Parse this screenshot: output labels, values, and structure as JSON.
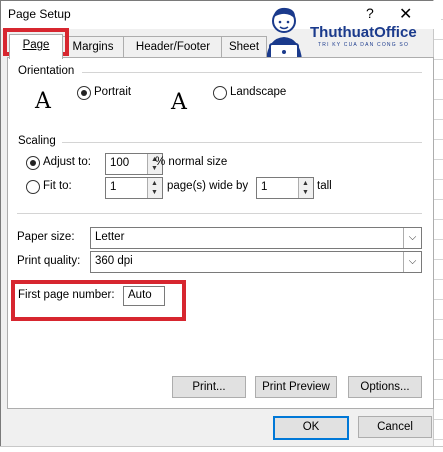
{
  "window": {
    "title": "Page Setup",
    "help_glyph": "?",
    "close_glyph": "✕"
  },
  "watermark": {
    "name": "ThuthuatOffice",
    "tagline": "TRI KY CUA DAN CONG SO"
  },
  "tabs": [
    {
      "label": "Page",
      "active": true
    },
    {
      "label": "Margins"
    },
    {
      "label": "Header/Footer"
    },
    {
      "label": "Sheet"
    }
  ],
  "orientation": {
    "heading": "Orientation",
    "portrait_label": "Portrait",
    "landscape_label": "Landscape",
    "icon_glyph": "A",
    "selected": "portrait"
  },
  "scaling": {
    "heading": "Scaling",
    "adjust_label": "Adjust to:",
    "adjust_value": "100",
    "adjust_suffix": "% normal size",
    "fit_label": "Fit to:",
    "fit_wide_value": "1",
    "fit_wide_suffix": "page(s) wide by",
    "fit_tall_value": "1",
    "fit_tall_suffix": "tall",
    "selected": "adjust"
  },
  "paper": {
    "size_label": "Paper size:",
    "size_value": "Letter",
    "quality_label": "Print quality:",
    "quality_value": "360 dpi"
  },
  "first_page": {
    "label": "First page number:",
    "value": "Auto"
  },
  "actions": {
    "print": "Print...",
    "preview": "Print Preview",
    "options": "Options..."
  },
  "footer": {
    "ok": "OK",
    "cancel": "Cancel"
  },
  "colors": {
    "highlight": "#d7262f",
    "accent": "#0078d7",
    "brand": "#1a3a8c"
  }
}
